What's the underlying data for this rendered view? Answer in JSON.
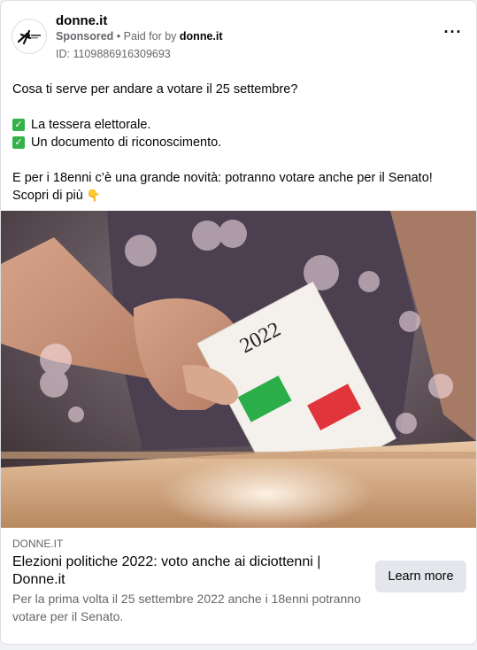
{
  "post": {
    "page_name": "donne.it",
    "sponsored": "Sponsored",
    "separator": "•",
    "paid_for_by_label": "Paid for by",
    "paid_for_by_name": "donne.it",
    "ad_id": "ID: 1109886916309693",
    "more_icon": "ellipsis-icon"
  },
  "body": {
    "intro": "Cosa ti serve per andare a votare il 25 settembre?",
    "checklist": [
      "La tessera elettorale.",
      "Un documento di riconoscimento."
    ],
    "closing": "E per i 18enni c’è una grande novità: potranno votare anche per il Senato! Scopri di più",
    "closing_emoji": "👇"
  },
  "media": {
    "ballot_year": "2022",
    "flag_colors": [
      "#2bae4a",
      "#e0353b"
    ]
  },
  "link": {
    "domain": "DONNE.IT",
    "title": "Elezioni politiche 2022: voto anche ai diciottenni | Donne.it",
    "description": "Per la prima volta il 25 settembre 2022 anche i 18enni potranno votare per il Senato.",
    "cta": "Learn more"
  }
}
